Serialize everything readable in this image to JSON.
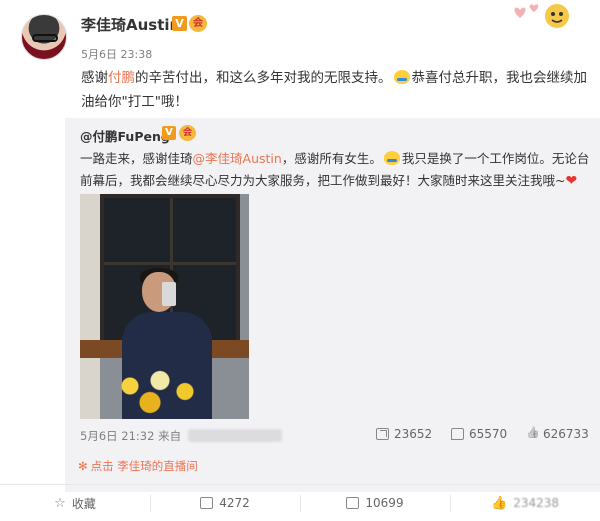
{
  "post": {
    "author": "李佳琦Austin",
    "timestamp": "5月6日 23:38",
    "text_parts": [
      "感谢",
      "付鹏",
      "的辛苦付出，和这么多年对我的无限支持。",
      "恭喜付总升职，我也会继续加油给你\"打工\"哦！"
    ]
  },
  "repost": {
    "author": "@付鹏FuPeng",
    "text_parts": [
      "一路走来，感谢佳琦",
      "@李佳琦Austin",
      "，感谢所有女生。",
      "我只是换了一个工作岗位。无论台前幕后，我都会继续尽心尽力为大家服务，把工作做到最好！大家随时来这里关注我哦~"
    ],
    "time": "5月6日 21:32",
    "from_label": "来自",
    "stats": {
      "forwards": "23652",
      "comments": "65570",
      "likes": "626733"
    }
  },
  "live_link": "点击 李佳琦的直播间",
  "footer": {
    "favorite": "收藏",
    "forwards": "4272",
    "comments": "10699",
    "likes": "234238"
  },
  "colors": {
    "mention": "#eb7350",
    "vip_badge": "#f09b1e",
    "repost_bg": "#f2f2f5"
  },
  "icons": [
    "star-icon",
    "forward-icon",
    "comment-icon",
    "like-icon",
    "heart-icon",
    "emoji-icon",
    "verified-badge-icon"
  ]
}
